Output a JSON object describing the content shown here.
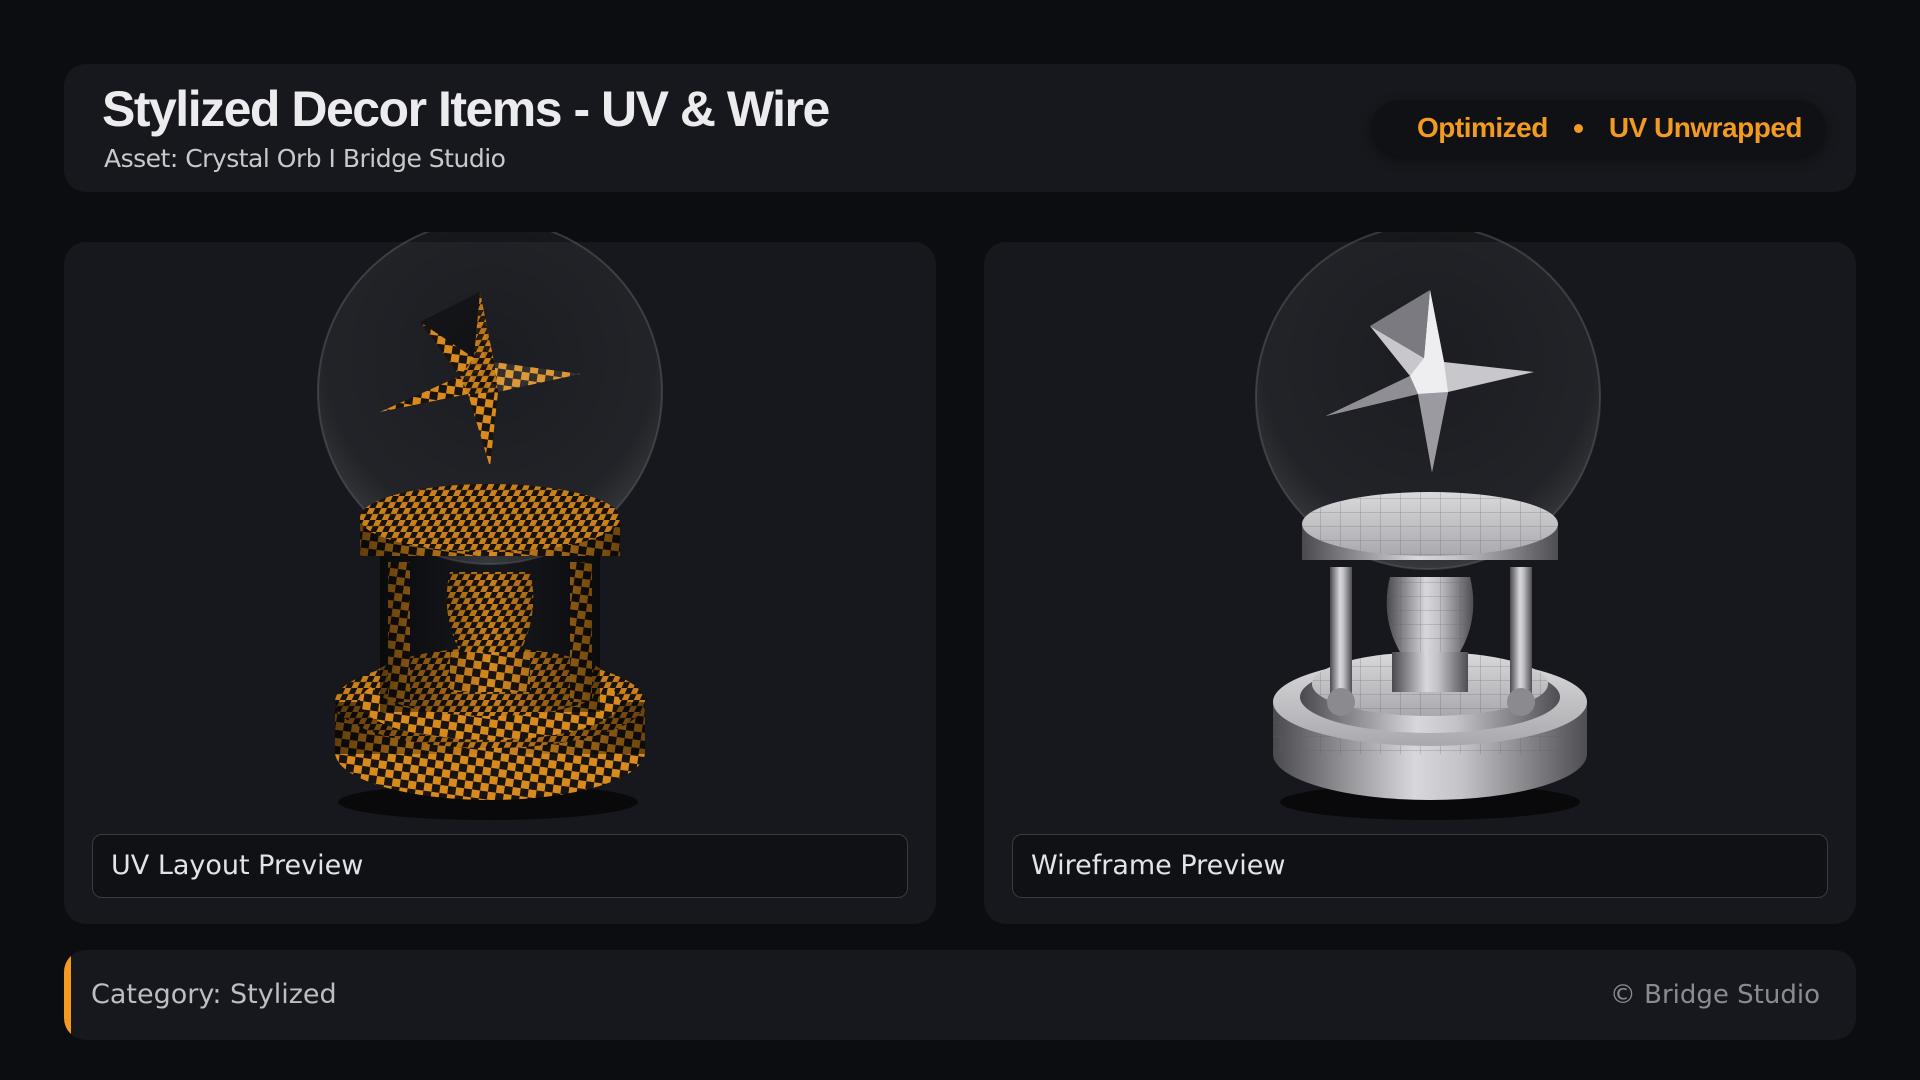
{
  "header": {
    "title": "Stylized Decor Items - UV & Wire",
    "subtitle": "Asset: Crystal Orb I Bridge Studio",
    "badges": [
      "Optimized",
      "UV Unwrapped"
    ]
  },
  "panels": [
    {
      "caption": "UV Layout Preview",
      "image": "crystal-orb-checker-render"
    },
    {
      "caption": "Wireframe Preview",
      "image": "crystal-orb-wireframe-render"
    }
  ],
  "footer": {
    "category": "Category: Stylized",
    "copyright": "© Bridge Studio"
  },
  "colors": {
    "accent": "#f39a21",
    "background": "#0c0d10",
    "card": "#17181d"
  }
}
